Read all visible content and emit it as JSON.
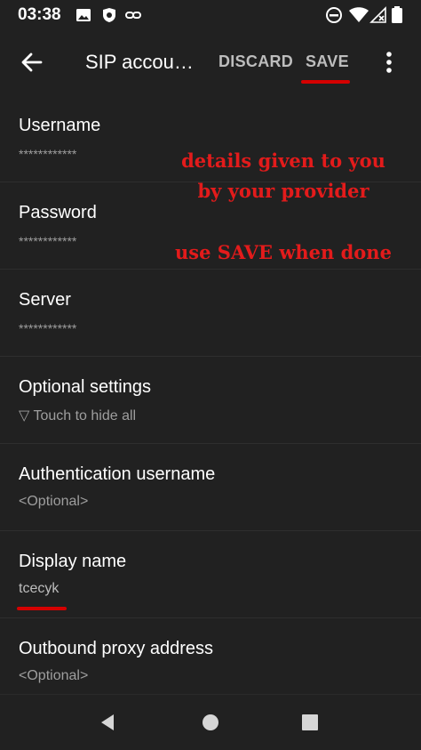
{
  "status_bar": {
    "time": "03:38",
    "left_icons": [
      "image-icon",
      "shield-app-icon",
      "link-icon"
    ],
    "right_icons": [
      "do-not-disturb-icon",
      "wifi-icon",
      "signal-no-data-icon",
      "battery-icon"
    ]
  },
  "app_bar": {
    "title": "SIP accou…",
    "discard_label": "DISCARD",
    "save_label": "SAVE"
  },
  "preferences": [
    {
      "title": "Username",
      "summary": "************"
    },
    {
      "title": "Password",
      "summary": "************"
    },
    {
      "title": "Server",
      "summary": "************"
    },
    {
      "title": "Optional settings",
      "summary": "▽  Touch to hide all"
    },
    {
      "title": "Authentication username",
      "summary": "<Optional>"
    },
    {
      "title": "Display name",
      "summary": "tcecyk"
    },
    {
      "title": "Outbound proxy address",
      "summary": "<Optional>"
    }
  ],
  "annotations": {
    "line1": "details given to you",
    "line2": "by your provider",
    "line3": "use SAVE when done"
  },
  "colors": {
    "background": "#212121",
    "annotation": "#e31b1b",
    "highlight": "#d50000"
  },
  "nav_bar": [
    "back-triangle-icon",
    "home-circle-icon",
    "recents-square-icon"
  ]
}
